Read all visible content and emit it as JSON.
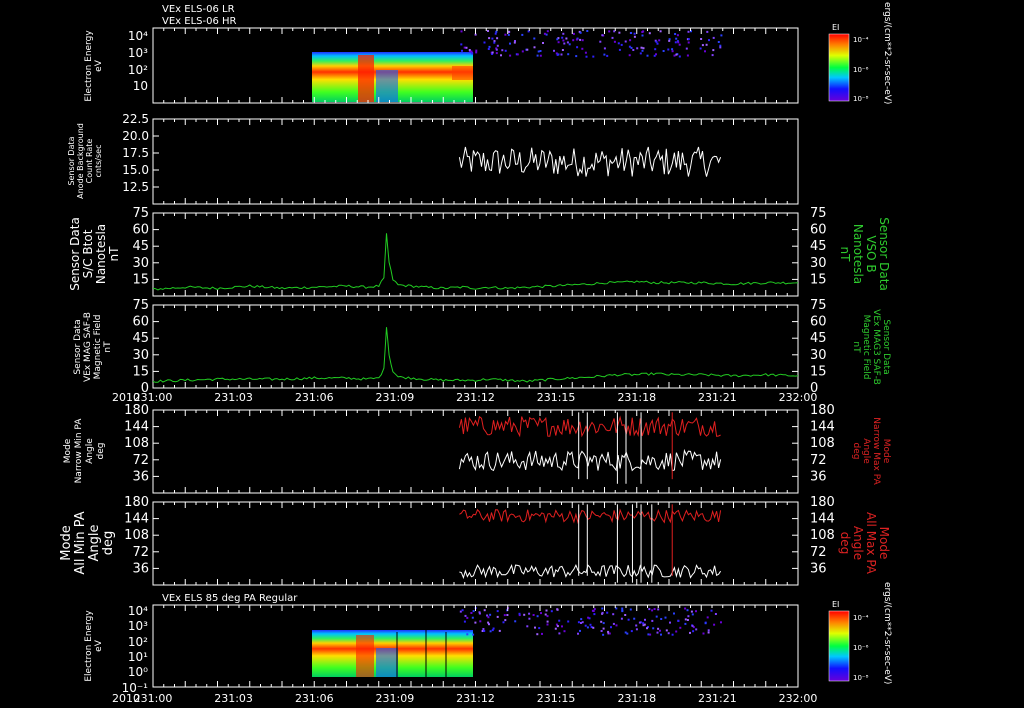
{
  "header": {
    "lines": [
      "VEx ELS-06 LR",
      "VEx ELS-06 HR"
    ]
  },
  "time_axis": {
    "year_label": "2010",
    "tick_labels": [
      "231:00",
      "231:03",
      "231:06",
      "231:09",
      "231:12",
      "231:15",
      "231:18",
      "231:21",
      "232:00"
    ],
    "range_minutes": [
      0,
      60
    ],
    "data_span_minutes": [
      28.5,
      52.8
    ]
  },
  "colors": {
    "background": "#000000",
    "frame": "#ffffff",
    "green_trace": "#22cc22",
    "green_label": "#2ecc2e",
    "red_trace": "#e02020",
    "red_label": "#dd2222",
    "white_trace": "#ffffff"
  },
  "chart_data": [
    {
      "id": "panel1",
      "type": "heatmap",
      "title_lines": [],
      "ylabel_lines": [
        "Electron Energy",
        "eV"
      ],
      "y_tick_labels": [
        "10",
        "10²",
        "10³",
        "10⁴"
      ],
      "y_scale": "log",
      "colorbar": {
        "title": "EI",
        "tick_labels": [
          "10⁻⁴",
          "10⁻⁶",
          "10⁻⁸"
        ],
        "unit_label": "ergs/(cm**2-sr-sec-eV)"
      },
      "grid": false
    },
    {
      "id": "panel2",
      "type": "line",
      "ylabel_lines": [
        "Sensor Data",
        "Anode Background",
        "Count Rate",
        "cnts/sec"
      ],
      "ylim": [
        10,
        22.5
      ],
      "y_tick_values": [
        12.5,
        15.0,
        17.5,
        20.0,
        22.5
      ],
      "y_tick_labels": [
        "12.5",
        "15.0",
        "17.5",
        "20.0",
        "22.5"
      ],
      "series": [
        {
          "color": "#ffffff",
          "x_range_minutes": [
            28.5,
            52.8
          ],
          "mean": 16.2,
          "noise": 2.2
        }
      ]
    },
    {
      "id": "panel3",
      "type": "line",
      "ylabel_lines": [
        "Sensor Data",
        "S/C Btot",
        "Nanotesla",
        "nT"
      ],
      "right_label_lines": [
        "Sensor Data",
        "VSO B",
        "Nanotesla",
        "nT"
      ],
      "ylim": [
        0,
        75
      ],
      "y_tick_values": [
        15,
        30,
        45,
        60,
        75
      ],
      "y_tick_labels": [
        "15",
        "30",
        "45",
        "60",
        "75"
      ],
      "series": [
        {
          "color": "#22cc22",
          "x": [
            0,
            5,
            10,
            15,
            20,
            25,
            30,
            33,
            35,
            35.8,
            36.2,
            36.6,
            37.2,
            38,
            40,
            42,
            45,
            48,
            50,
            52,
            55,
            58,
            62,
            65,
            68,
            70,
            72,
            75,
            78,
            80,
            85,
            90,
            95,
            100
          ],
          "y": [
            6,
            8,
            7,
            9,
            7,
            8,
            9,
            8,
            9,
            16,
            56,
            30,
            15,
            10,
            9,
            8,
            7,
            8,
            7,
            8,
            7,
            8,
            9,
            10,
            11,
            12,
            12,
            13,
            12,
            12,
            12,
            11,
            12,
            12
          ]
        }
      ]
    },
    {
      "id": "panel4",
      "type": "line",
      "ylabel_lines": [
        "Sensor Data",
        "VEx MAG SAF-B",
        "Magnetic Field",
        "nT"
      ],
      "right_label_lines": [
        "Sensor Data",
        "VEx MAG3 SAF-B",
        "Magnetic Field",
        "nT"
      ],
      "ylim": [
        0,
        75
      ],
      "y_tick_values": [
        0,
        15,
        30,
        45,
        60,
        75
      ],
      "y_tick_labels": [
        "0",
        "15",
        "30",
        "45",
        "60",
        "75"
      ],
      "series": [
        {
          "color": "#22cc22",
          "x": [
            0,
            5,
            10,
            15,
            20,
            25,
            30,
            33,
            35,
            35.8,
            36.2,
            36.6,
            37.2,
            38,
            40,
            42,
            45,
            48,
            50,
            52,
            55,
            58,
            62,
            65,
            68,
            70,
            72,
            75,
            78,
            80,
            85,
            90,
            95,
            100
          ],
          "y": [
            6,
            7,
            8,
            8,
            8,
            9,
            9,
            8,
            9,
            17,
            56,
            30,
            15,
            10,
            9,
            8,
            7,
            7,
            7,
            8,
            7,
            6,
            8,
            9,
            10,
            11,
            12,
            12,
            13,
            12,
            12,
            11,
            12,
            11
          ]
        }
      ]
    },
    {
      "id": "panel5",
      "type": "line",
      "ylabel_lines": [
        "Mode",
        "Narrow Min PA",
        "Angle",
        "deg"
      ],
      "right_label_lines": [
        "Mode",
        "Narrow Max PA",
        "Angle",
        "deg"
      ],
      "ylim": [
        0,
        180
      ],
      "y_tick_values": [
        36,
        72,
        108,
        144,
        180
      ],
      "y_tick_labels": [
        "36",
        "72",
        "108",
        "144",
        "180"
      ],
      "series": [
        {
          "color": "#e02020",
          "role": "max",
          "x_range_minutes": [
            28.5,
            52.8
          ],
          "mean": 145,
          "noise": 22
        },
        {
          "color": "#ffffff",
          "role": "min",
          "x_range_minutes": [
            28.5,
            52.8
          ],
          "mean": 70,
          "noise": 22
        }
      ]
    },
    {
      "id": "panel6",
      "type": "line",
      "ylabel_lines": [
        "Mode",
        "All Min PA",
        "Angle",
        "deg"
      ],
      "right_label_lines": [
        "Mode",
        "All Max PA",
        "Angle",
        "deg"
      ],
      "ylim": [
        0,
        180
      ],
      "y_tick_values": [
        36,
        72,
        108,
        144,
        180
      ],
      "y_tick_labels": [
        "36",
        "72",
        "108",
        "144",
        "180"
      ],
      "series": [
        {
          "color": "#e02020",
          "role": "max",
          "x_range_minutes": [
            28.5,
            52.8
          ],
          "mean": 150,
          "noise": 14
        },
        {
          "color": "#ffffff",
          "role": "min",
          "x_range_minutes": [
            28.5,
            52.8
          ],
          "mean": 30,
          "noise": 14
        }
      ]
    },
    {
      "id": "panel7",
      "type": "heatmap",
      "title_lines": [
        "VEx ELS 85 deg PA Regular"
      ],
      "ylabel_lines": [
        "Electron Energy",
        "eV"
      ],
      "y_tick_labels": [
        "10⁻¹",
        "10⁰",
        "10¹",
        "10²",
        "10³",
        "10⁴"
      ],
      "y_scale": "log",
      "colorbar": {
        "title": "EI",
        "tick_labels": [
          "10⁻⁴",
          "10⁻⁶",
          "10⁻⁸"
        ],
        "unit_label": "ergs/(cm**2-sr-sec-eV)"
      },
      "grid": false
    }
  ]
}
